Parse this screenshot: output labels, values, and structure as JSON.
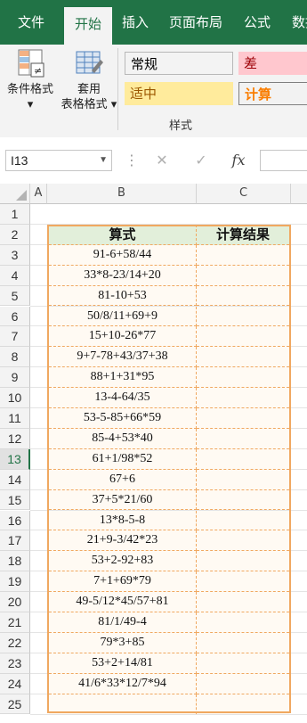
{
  "tabs": [
    "文件",
    "开始",
    "插入",
    "页面布局",
    "公式",
    "数据"
  ],
  "active_tab": "开始",
  "ribbon": {
    "cond_format": [
      "条件格式",
      "▾"
    ],
    "table_format": [
      "套用",
      "表格格式 ▾"
    ],
    "styles": [
      {
        "label": "常规",
        "bg": "#ffffff",
        "color": "#222222"
      },
      {
        "label": "差",
        "bg": "#ffc7ce",
        "color": "#9c0006"
      },
      {
        "label": "适中",
        "bg": "#ffeb9c",
        "color": "#9c5700"
      },
      {
        "label": "计算",
        "bg": "#f2f2f2",
        "color": "#fa7d00"
      }
    ],
    "group_label": "样式"
  },
  "formula_bar": {
    "name_box": "I13",
    "cancel_icon": "✕",
    "enter_icon": "✓",
    "fx_label": "fx",
    "value": ""
  },
  "columns": [
    "A",
    "B",
    "C"
  ],
  "active_row": "13",
  "header": {
    "expr": "算式",
    "result": "计算结果"
  },
  "rows": [
    {
      "n": "1",
      "expr": "",
      "result": ""
    },
    {
      "n": "2",
      "expr": "",
      "result": ""
    },
    {
      "n": "3",
      "expr": "91-6+58/44",
      "result": ""
    },
    {
      "n": "4",
      "expr": "33*8-23/14+20",
      "result": ""
    },
    {
      "n": "5",
      "expr": "81-10+53",
      "result": ""
    },
    {
      "n": "6",
      "expr": "50/8/11+69+9",
      "result": ""
    },
    {
      "n": "7",
      "expr": "15+10-26*77",
      "result": ""
    },
    {
      "n": "8",
      "expr": "9+7-78+43/37+38",
      "result": ""
    },
    {
      "n": "9",
      "expr": "88+1+31*95",
      "result": ""
    },
    {
      "n": "10",
      "expr": "13-4-64/35",
      "result": ""
    },
    {
      "n": "11",
      "expr": "53-5-85+66*59",
      "result": ""
    },
    {
      "n": "12",
      "expr": "85-4+53*40",
      "result": ""
    },
    {
      "n": "13",
      "expr": "61+1/98*52",
      "result": ""
    },
    {
      "n": "14",
      "expr": "67+6",
      "result": ""
    },
    {
      "n": "15",
      "expr": "37+5*21/60",
      "result": ""
    },
    {
      "n": "16",
      "expr": "13*8-5-8",
      "result": ""
    },
    {
      "n": "17",
      "expr": "21+9-3/42*23",
      "result": ""
    },
    {
      "n": "18",
      "expr": "53+2-92+83",
      "result": ""
    },
    {
      "n": "19",
      "expr": "7+1+69*79",
      "result": ""
    },
    {
      "n": "20",
      "expr": "49-5/12*45/57+81",
      "result": ""
    },
    {
      "n": "21",
      "expr": "81/1/49-4",
      "result": ""
    },
    {
      "n": "22",
      "expr": "79*3+85",
      "result": ""
    },
    {
      "n": "23",
      "expr": "53+2+14/81",
      "result": ""
    },
    {
      "n": "24",
      "expr": "41/6*33*12/7*94",
      "result": ""
    },
    {
      "n": "25",
      "expr": "",
      "result": ""
    }
  ],
  "colors": {
    "brand": "#217346",
    "table_border": "#f0a860",
    "header_fill": "#e2efda",
    "cell_fill": "#fffaf3"
  }
}
